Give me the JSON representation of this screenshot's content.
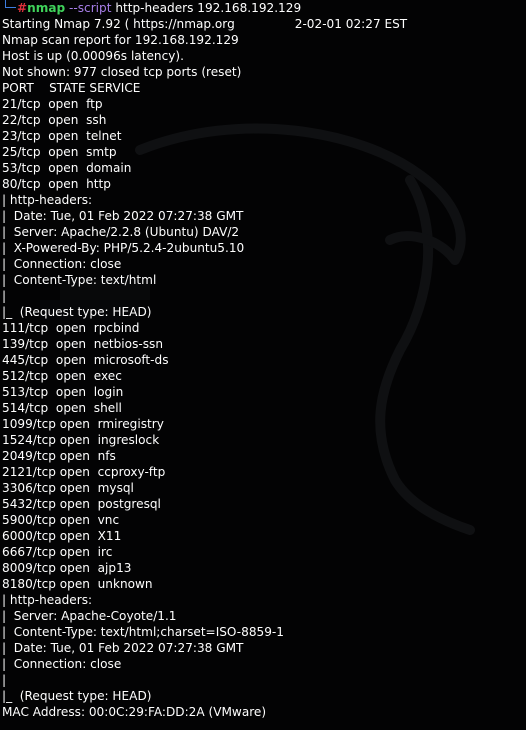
{
  "colors": {
    "background": "#030304",
    "text": "#ffffff",
    "prompt_corner": "#3d7de0",
    "prompt_hash": "#e0313b",
    "command": "#3fd25a",
    "option": "#a77ee8"
  },
  "prompt": {
    "symbol": "#",
    "command": "nmap",
    "option": "--script",
    "args": "http-headers 192.168.192.129"
  },
  "header": {
    "starting": "Starting Nmap 7.92 ( https://nmap.org",
    "timestamp": "2-02-01 02:27 EST"
  },
  "lines": [
    "Nmap scan report for 192.168.192.129",
    "Host is up (0.00096s latency).",
    "Not shown: 977 closed tcp ports (reset)",
    "PORT    STATE SERVICE",
    "21/tcp  open  ftp",
    "22/tcp  open  ssh",
    "23/tcp  open  telnet",
    "25/tcp  open  smtp",
    "53/tcp  open  domain",
    "80/tcp  open  http",
    "| http-headers:",
    "|  Date: Tue, 01 Feb 2022 07:27:38 GMT",
    "|  Server: Apache/2.2.8 (Ubuntu) DAV/2",
    "|  X-Powered-By: PHP/5.2.4-2ubuntu5.10",
    "|  Connection: close",
    "|  Content-Type: text/html",
    "|",
    "|_  (Request type: HEAD)",
    "111/tcp  open  rpcbind",
    "139/tcp  open  netbios-ssn",
    "445/tcp  open  microsoft-ds",
    "512/tcp  open  exec",
    "513/tcp  open  login",
    "514/tcp  open  shell",
    "1099/tcp open  rmiregistry",
    "1524/tcp open  ingreslock",
    "2049/tcp open  nfs",
    "2121/tcp open  ccproxy-ftp",
    "3306/tcp open  mysql",
    "5432/tcp open  postgresql",
    "5900/tcp open  vnc",
    "6000/tcp open  X11",
    "6667/tcp open  irc",
    "8009/tcp open  ajp13",
    "8180/tcp open  unknown",
    "| http-headers:",
    "|  Server: Apache-Coyote/1.1",
    "|  Content-Type: text/html;charset=ISO-8859-1",
    "|  Date: Tue, 01 Feb 2022 07:27:38 GMT",
    "|  Connection: close",
    "|",
    "|_  (Request type: HEAD)",
    "MAC Address: 00:0C:29:FA:DD:2A (VMware)"
  ]
}
